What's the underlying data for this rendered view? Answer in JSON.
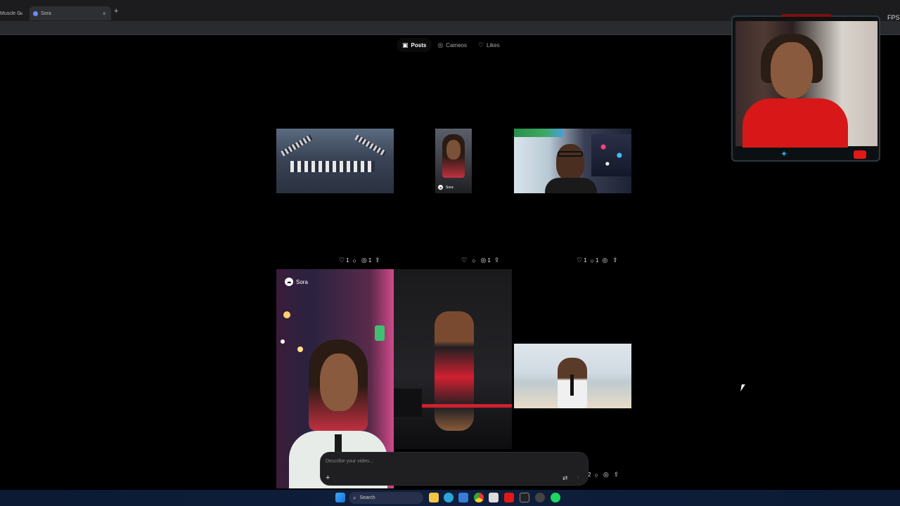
{
  "browser": {
    "tabs": [
      {
        "label": "Muscle G"
      },
      {
        "label": "Sora"
      }
    ],
    "new_tab": "+",
    "close": "×",
    "overlay_text": "FPS"
  },
  "profile_tabs": [
    {
      "label": "Posts",
      "icon": "posts-icon",
      "active": true
    },
    {
      "label": "Cameos",
      "icon": "cameos-icon",
      "active": false
    },
    {
      "label": "Likes",
      "icon": "heart-icon",
      "active": false
    }
  ],
  "posts": [
    {
      "badge": "",
      "likes": "1",
      "comments": "",
      "remixes": "1"
    },
    {
      "badge": "Sora",
      "likes": "",
      "comments": "",
      "remixes": "1"
    },
    {
      "badge": "",
      "likes": "1",
      "comments": "1",
      "remixes": ""
    },
    {
      "badge": "Sora",
      "likes": "",
      "comments": "",
      "remixes": ""
    },
    {
      "badge": "",
      "likes": "",
      "comments": "",
      "remixes": ""
    },
    {
      "badge": "",
      "likes": "2",
      "comments": "",
      "remixes": ""
    }
  ],
  "composer": {
    "placeholder": "Describe your video...",
    "plus": "+",
    "settings_icon": "sliders-icon",
    "send_icon": "arrow-up-icon"
  },
  "taskbar": {
    "search_label": "Search"
  },
  "colors": {
    "background": "#000000",
    "accent_red": "#d02030",
    "twitter_blue": "#29a8e8",
    "youtube_red": "#e01818"
  }
}
